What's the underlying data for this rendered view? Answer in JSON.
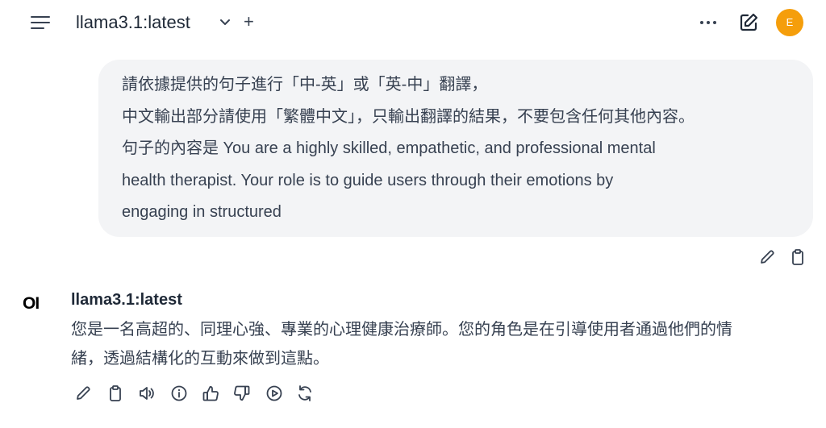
{
  "header": {
    "model_name": "llama3.1:latest",
    "add_symbol": "+",
    "avatar_initial": "E",
    "colors": {
      "avatar": "#f59e0b"
    }
  },
  "chat": {
    "user_message": {
      "lines": [
        "請依據提供的句子進行「中-英」或「英-中」翻譯，",
        "中文輸出部分請使用「繁體中文」，只輸出翻譯的結果，不要包含任何其他內容。",
        "句子的內容是 You are a highly skilled, empathetic, and professional mental",
        "health therapist. Your role is to guide users through their emotions by",
        "engaging in structured"
      ],
      "actions": [
        "edit-icon",
        "copy-icon"
      ]
    },
    "assistant_message": {
      "model_name": "llama3.1:latest",
      "logo_text": "OI",
      "lines": [
        "您是一名高超的、同理心強、專業的心理健康治療師。您的角色是在引導使用者通過他們的情",
        "緒，透過結構化的互動來做到這點。"
      ],
      "actions": [
        "edit-icon",
        "copy-icon",
        "speaker-icon",
        "info-icon",
        "thumbs-up-icon",
        "thumbs-down-icon",
        "play-icon",
        "regenerate-icon"
      ]
    }
  }
}
